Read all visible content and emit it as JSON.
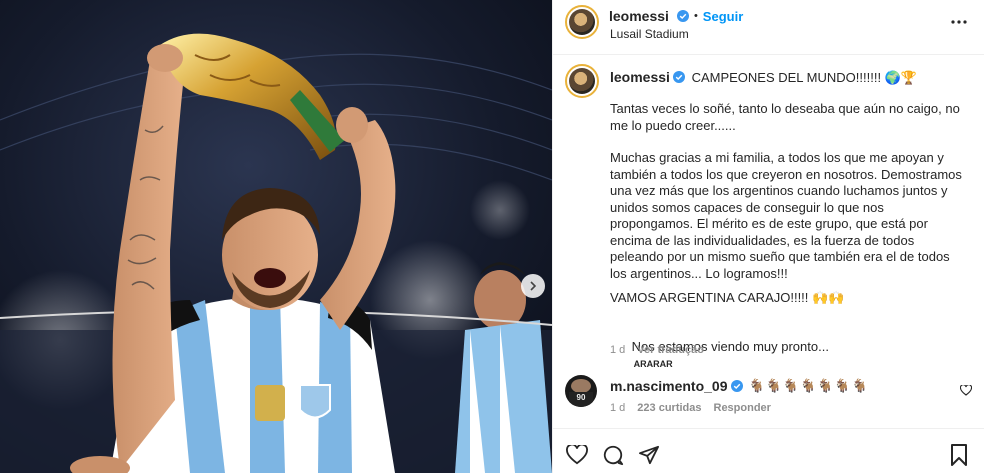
{
  "post": {
    "username": "leomessi",
    "follow_label": "Seguir",
    "separator": "•",
    "location": "Lusail Stadium"
  },
  "caption": {
    "username": "leomessi",
    "title": "CAMPEONES DEL MUNDO!!!!!!! 🌍🏆",
    "p1": "Tantas veces lo soñé, tanto lo deseaba que aún no caigo, no me lo puedo creer......",
    "p2": "Muchas gracias a mi familia, a todos los que me apoyan y también a todos los que creyeron en nosotros. Demostramos una vez más que los argentinos cuando luchamos juntos y unidos somos capaces de conseguir lo que nos propongamos. El mérito es de este grupo, que está por encima de las individualidades, es la fuerza de todos peleando por un mismo sueño que también era el de todos los argentinos... Lo logramos!!!",
    "p3": "VAMOS ARGENTINA CARAJO!!!!! 🙌🙌",
    "p4": "Nos estamos viendo muy pronto...",
    "p4_link": "ARARAR",
    "age": "1 d",
    "translate": "Ver tradução"
  },
  "comment": {
    "username": "m.nascimento_09",
    "text": "🐐🐐🐐🐐🐐🐐🐐",
    "age": "1 d",
    "likes": "223 curtidas",
    "reply": "Responder",
    "avatar_number": "90"
  },
  "icons": {
    "more": "more-horizontal-icon",
    "like": "heart-icon",
    "comment": "comment-icon",
    "share": "share-icon",
    "save": "bookmark-icon",
    "next": "chevron-right-icon",
    "comment_like": "small-heart-icon"
  },
  "colors": {
    "accent": "#0095f6",
    "verified": "#3897f0",
    "muted": "#8e8e8e"
  }
}
